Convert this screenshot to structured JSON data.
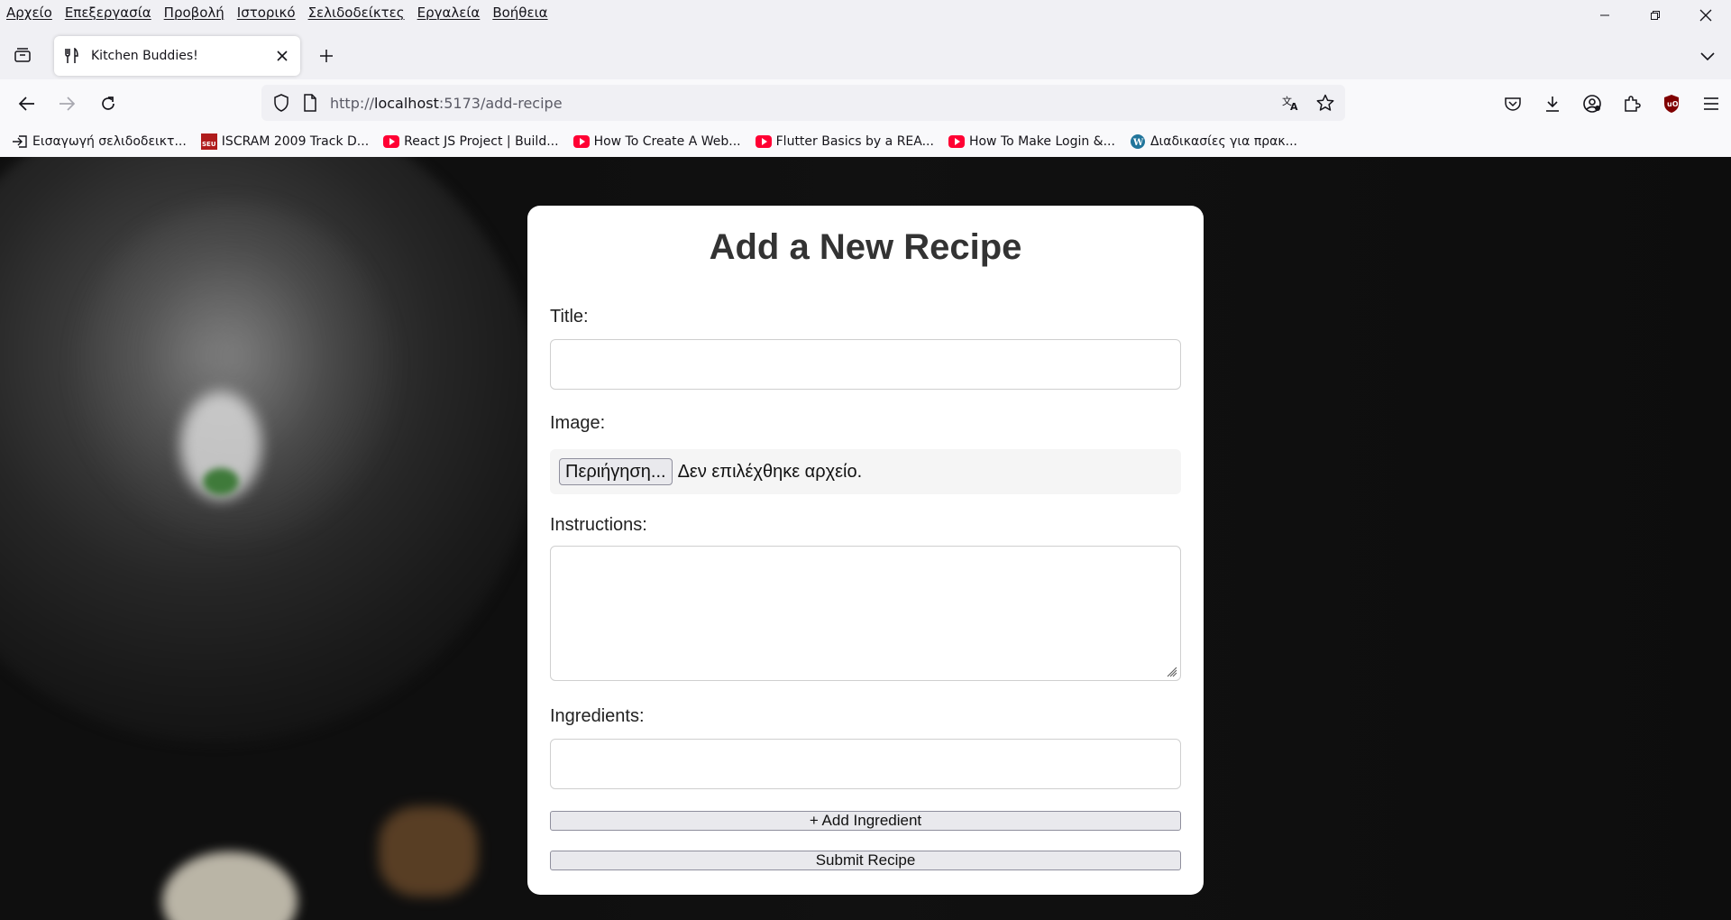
{
  "menubar": {
    "items": [
      "Αρχείο",
      "Επεξεργασία",
      "Προβολή",
      "Ιστορικό",
      "Σελιδοδείκτες",
      "Εργαλεία",
      "Βοήθεια"
    ]
  },
  "tab": {
    "title": "Kitchen Buddies!",
    "icon": "fork-knife-icon"
  },
  "urlbar": {
    "prefix": "http://",
    "host": "localhost",
    "rest": ":5173/add-recipe"
  },
  "bookmarks": [
    {
      "label": "Εισαγωγή σελιδοδεικτ...",
      "icon": "import-icon"
    },
    {
      "label": "ISCRAM 2009 Track D...",
      "icon": "seu-icon"
    },
    {
      "label": "React JS Project | Build...",
      "icon": "youtube-icon"
    },
    {
      "label": "How To Create A Web...",
      "icon": "youtube-icon"
    },
    {
      "label": "Flutter Basics by a REA...",
      "icon": "youtube-icon"
    },
    {
      "label": "How To Make Login &...",
      "icon": "youtube-icon"
    },
    {
      "label": "Διαδικασίες για πρακ...",
      "icon": "wordpress-icon"
    }
  ],
  "form": {
    "heading": "Add a New Recipe",
    "title_label": "Title:",
    "title_value": "",
    "image_label": "Image:",
    "file_button": "Περιήγηση...",
    "file_status": "Δεν επιλέχθηκε αρχείο.",
    "instructions_label": "Instructions:",
    "instructions_value": "",
    "ingredients_label": "Ingredients:",
    "ingredient_value": "",
    "add_ingredient": "+ Add Ingredient",
    "submit": "Submit Recipe"
  }
}
